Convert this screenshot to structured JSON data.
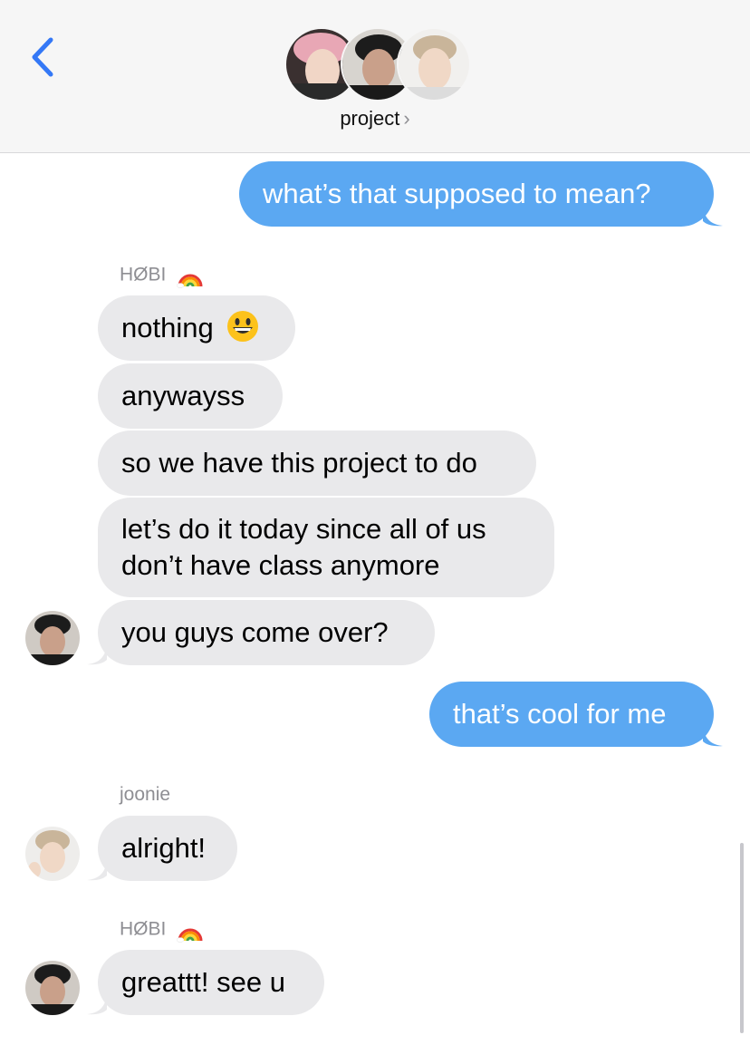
{
  "header": {
    "group_name": "project",
    "chevron": "›",
    "back_icon": "chevron-left-icon",
    "accent_color": "#3478f6"
  },
  "messages": [
    {
      "direction": "out",
      "text": "what’s that supposed to mean?"
    },
    {
      "direction": "in",
      "sender": "HØBI",
      "text": "nothing"
    },
    {
      "direction": "in",
      "text": "anywayss"
    },
    {
      "direction": "in",
      "text": "so we have this project to do"
    },
    {
      "direction": "in",
      "line1": "let’s do it today since all of us",
      "line2": "don’t have class anymore"
    },
    {
      "direction": "in",
      "text": "you guys come over?"
    },
    {
      "direction": "out",
      "text": "that’s cool for me"
    },
    {
      "direction": "in",
      "sender": "joonie",
      "text": "alright!"
    },
    {
      "direction": "in",
      "sender": "HØBI",
      "text": "greattt! see u"
    }
  ],
  "colors": {
    "outgoing_bubble": "#5ba8f2",
    "incoming_bubble": "#e9e9eb",
    "sender_name": "#8e8e93"
  }
}
